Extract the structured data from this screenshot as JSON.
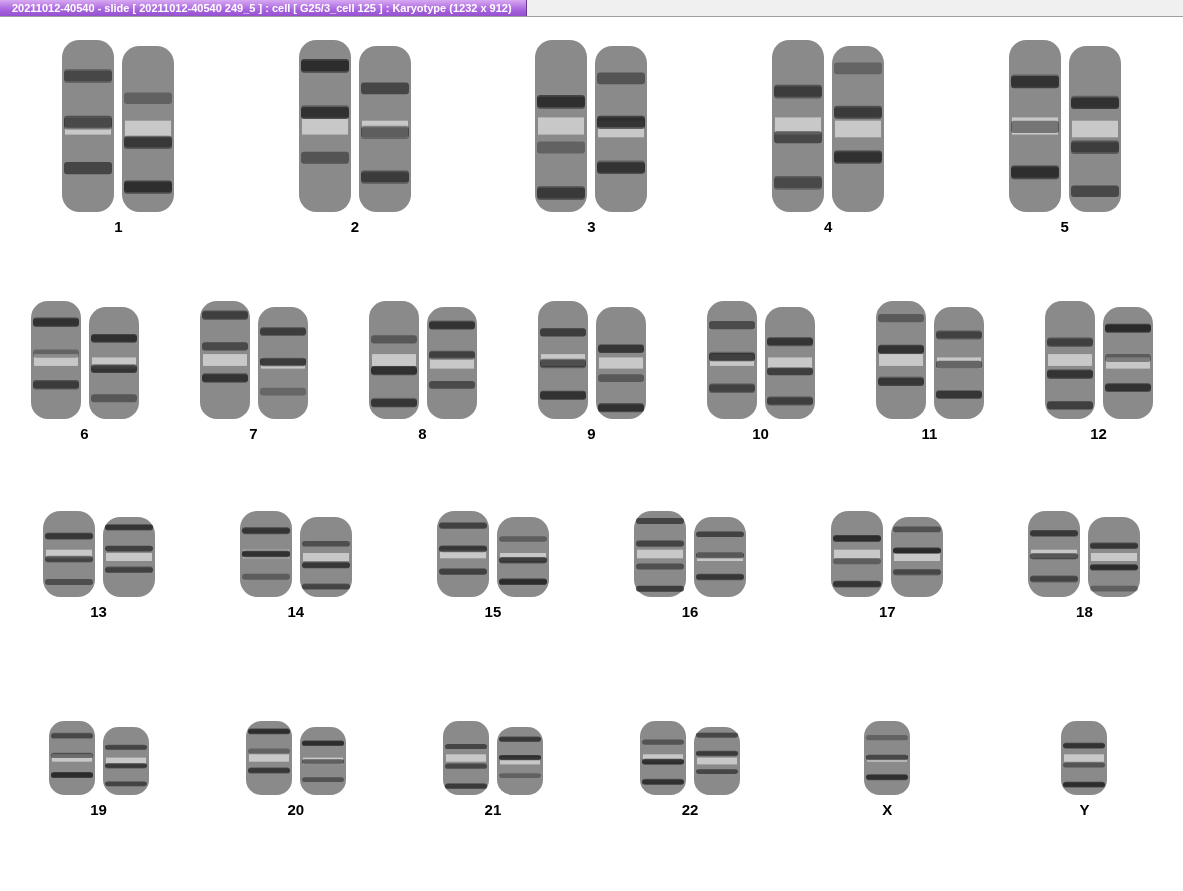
{
  "window": {
    "title": "20211012-40540 - slide [ 20211012-40540 249_5 ] : cell [ G25/3_cell 125 ] : Karyotype  (1232 x 912)"
  },
  "rows": [
    {
      "chromosomes": [
        {
          "label": "1",
          "kind": "pair"
        },
        {
          "label": "2",
          "kind": "pair"
        },
        {
          "label": "3",
          "kind": "pair"
        },
        {
          "label": "4",
          "kind": "pair"
        },
        {
          "label": "5",
          "kind": "pair"
        }
      ]
    },
    {
      "chromosomes": [
        {
          "label": "6",
          "kind": "pair"
        },
        {
          "label": "7",
          "kind": "pair"
        },
        {
          "label": "8",
          "kind": "pair"
        },
        {
          "label": "9",
          "kind": "pair"
        },
        {
          "label": "10",
          "kind": "pair"
        },
        {
          "label": "11",
          "kind": "pair"
        },
        {
          "label": "12",
          "kind": "pair"
        }
      ]
    },
    {
      "chromosomes": [
        {
          "label": "13",
          "kind": "pair"
        },
        {
          "label": "14",
          "kind": "pair"
        },
        {
          "label": "15",
          "kind": "pair"
        },
        {
          "label": "16",
          "kind": "pair"
        },
        {
          "label": "17",
          "kind": "pair"
        },
        {
          "label": "18",
          "kind": "pair"
        }
      ]
    },
    {
      "chromosomes": [
        {
          "label": "19",
          "kind": "pair"
        },
        {
          "label": "20",
          "kind": "pair"
        },
        {
          "label": "21",
          "kind": "pair"
        },
        {
          "label": "22",
          "kind": "pair"
        },
        {
          "label": "X",
          "kind": "single"
        },
        {
          "label": "Y",
          "kind": "single"
        }
      ]
    }
  ]
}
